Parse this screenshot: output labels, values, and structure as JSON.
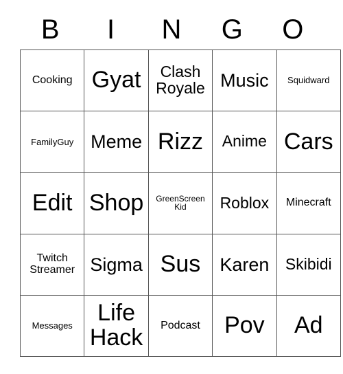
{
  "card": {
    "header_letters": [
      "B",
      "I",
      "N",
      "G",
      "O"
    ],
    "rows": [
      [
        {
          "label": "Cooking",
          "size": "fs-sm"
        },
        {
          "label": "Gyat",
          "size": "fs-xxl"
        },
        {
          "label": "Clash\nRoyale",
          "size": "fs-md"
        },
        {
          "label": "Music",
          "size": "fs-lg"
        },
        {
          "label": "Squidward",
          "size": "fs-xs"
        }
      ],
      [
        {
          "label": "FamilyGuy",
          "size": "fs-xs"
        },
        {
          "label": "Meme",
          "size": "fs-lg"
        },
        {
          "label": "Rizz",
          "size": "fs-xxl"
        },
        {
          "label": "Anime",
          "size": "fs-md"
        },
        {
          "label": "Cars",
          "size": "fs-xxl"
        }
      ],
      [
        {
          "label": "Edit",
          "size": "fs-xxl"
        },
        {
          "label": "Shop",
          "size": "fs-xxl"
        },
        {
          "label": "GreenScreen\nKid",
          "size": "fs-xxs"
        },
        {
          "label": "Roblox",
          "size": "fs-md"
        },
        {
          "label": "Minecraft",
          "size": "fs-sm"
        }
      ],
      [
        {
          "label": "Twitch\nStreamer",
          "size": "fs-sm"
        },
        {
          "label": "Sigma",
          "size": "fs-lg"
        },
        {
          "label": "Sus",
          "size": "fs-xxl"
        },
        {
          "label": "Karen",
          "size": "fs-lg"
        },
        {
          "label": "Skibidi",
          "size": "fs-md"
        }
      ],
      [
        {
          "label": "Messages",
          "size": "fs-xs"
        },
        {
          "label": "Life\nHack",
          "size": "fs-xxl"
        },
        {
          "label": "Podcast",
          "size": "fs-sm"
        },
        {
          "label": "Pov",
          "size": "fs-xxl"
        },
        {
          "label": "Ad",
          "size": "fs-xxl"
        }
      ]
    ]
  }
}
